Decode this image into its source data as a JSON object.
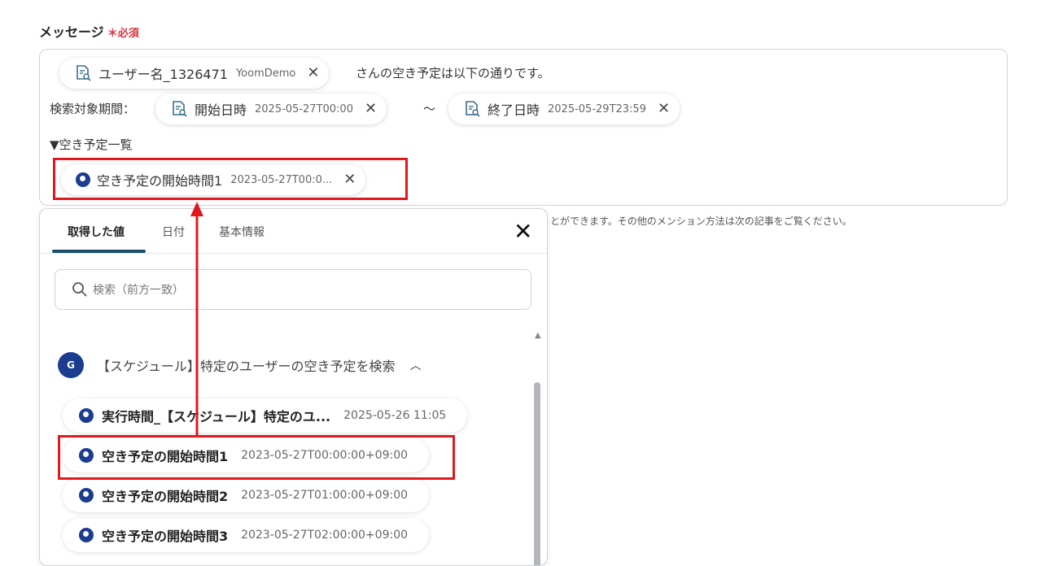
{
  "field": {
    "label": "メッセージ",
    "required_mark": "＊必須"
  },
  "editor": {
    "line1": {
      "chip": {
        "name": "ユーザー名_1326471",
        "value": "YoomDemo"
      },
      "text": "さんの空き予定は以下の通りです。"
    },
    "line2": {
      "prefix": "検索対象期間：",
      "chip_start": {
        "name": "開始日時",
        "value": "2025-05-27T00:00"
      },
      "tilde": "〜",
      "chip_end": {
        "name": "終了日時",
        "value": "2025-05-29T23:59"
      }
    },
    "line3": {
      "text": "▼空き予定一覧"
    },
    "line4": {
      "chip": {
        "name": "空き予定の開始時間1",
        "value": "2023-05-27T00:0..."
      }
    }
  },
  "hint_text": "とができます。その他のメンション方法は次の記事をご覧ください。",
  "panel": {
    "tabs": [
      {
        "label": "取得した値"
      },
      {
        "label": "日付"
      },
      {
        "label": "基本情報"
      }
    ],
    "close_symbol": "✕",
    "search": {
      "placeholder": "検索（前方一致）"
    },
    "group": {
      "icon_text": "G",
      "title": "【スケジュール】特定のユーザーの空き予定を検索"
    },
    "items": [
      {
        "name": "実行時間_【スケジュール】特定のユ...",
        "value": "2025-05-26 11:05"
      },
      {
        "name": "空き予定の開始時間1",
        "value": "2023-05-27T00:00:00+09:00"
      },
      {
        "name": "空き予定の開始時間2",
        "value": "2023-05-27T01:00:00+09:00"
      },
      {
        "name": "空き予定の開始時間3",
        "value": "2023-05-27T02:00:00+09:00"
      }
    ]
  },
  "colors": {
    "highlight": "#e0191f",
    "brand": "#1b3c8f",
    "tab_underline": "#1d4e6e"
  }
}
